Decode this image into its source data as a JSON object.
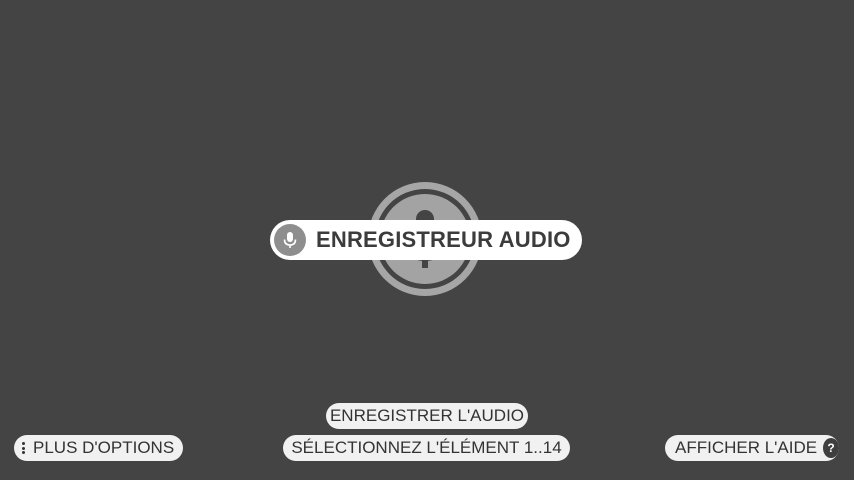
{
  "screen": {
    "background_color": "#444444"
  },
  "center": {
    "icon": "microphone-icon",
    "title_icon": "microphone-icon",
    "title": "ENREGISTREUR AUDIO"
  },
  "actions": {
    "record_label": "ENREGISTRER L'AUDIO",
    "select_label": "SÉLECTIONNEZ L'ÉLÉMENT 1..14",
    "more_options_label": "PLUS D'OPTIONS",
    "more_options_icon": "more-vertical-icon",
    "help_label": "AFFICHER L'AIDE",
    "help_icon": "help-icon",
    "help_glyph": "?"
  }
}
